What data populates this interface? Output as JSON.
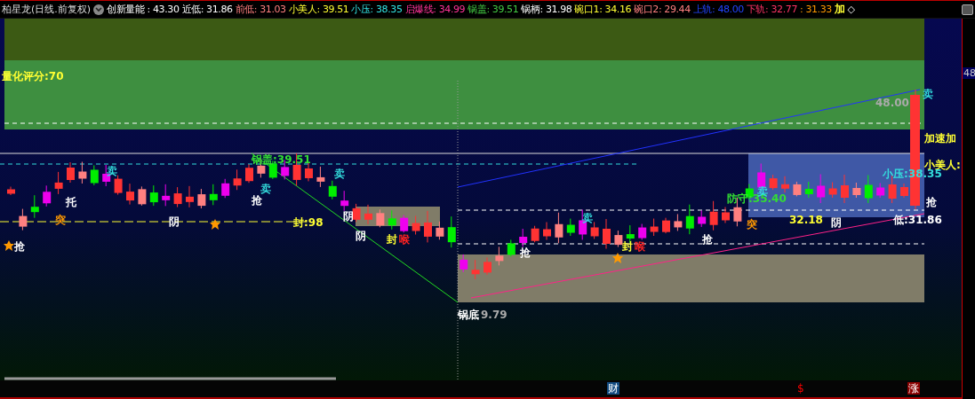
{
  "title": "柏星龙(日线.前复权)",
  "indicator": {
    "name": "创新量能",
    "value": ": 43.30"
  },
  "readings": [
    {
      "label": "近低:",
      "value": "31.86",
      "color": "#ffffff"
    },
    {
      "label": "前低:",
      "value": "31.03",
      "color": "#ff7f7f"
    },
    {
      "label": "小美人:",
      "value": "39.51",
      "color": "#ffff33"
    },
    {
      "label": "小压:",
      "value": "38.35",
      "color": "#33e6e6"
    },
    {
      "label": "启爆线:",
      "value": "34.99",
      "color": "#ff3399"
    },
    {
      "label": "锅盖:",
      "value": "39.51",
      "color": "#44cc44"
    },
    {
      "label": "锅柄:",
      "value": "31.98",
      "color": "#ffffff"
    },
    {
      "label": "碗口1:",
      "value": "34.16",
      "color": "#ffff33"
    },
    {
      "label": "碗口2:",
      "value": "29.44",
      "color": "#ff8080"
    },
    {
      "label": "上轨:",
      "value": "48.00",
      "color": "#2244ff"
    },
    {
      "label": "下轨:",
      "value": "32.77",
      "color": "#ff3366"
    },
    {
      "value": ": 31.33",
      "color": "#ff9900"
    },
    {
      "label": "加",
      "color": "#ffff33"
    }
  ],
  "collapse_symbol": "◇",
  "annotations": [
    {
      "text": "量化评分:70",
      "color": "#ffff33"
    },
    {
      "text": "锅盖:39.51",
      "color": "#33dd33"
    },
    {
      "text": "48.00",
      "color": "#aaaaaa"
    },
    {
      "text": "卖",
      "color": "#33dddd"
    },
    {
      "text": "加速加",
      "color": "#ffff33"
    },
    {
      "text": "卖",
      "color": "#33dddd"
    },
    {
      "text": "卖",
      "color": "#33dddd"
    },
    {
      "text": "卖",
      "color": "#33dddd"
    },
    {
      "text": "小美人:",
      "color": "#ffff33"
    },
    {
      "text": "小压:38.35",
      "color": "#33dddd"
    },
    {
      "text": "托",
      "color": "#ffffff"
    },
    {
      "text": "突",
      "color": "#ff9900"
    },
    {
      "text": "阴",
      "color": "#ffffff"
    },
    {
      "text": "抢",
      "color": "#ffffff"
    },
    {
      "text": "抢",
      "color": "#ffffff"
    },
    {
      "text": "封:98",
      "color": "#ffff33"
    },
    {
      "text": "阴",
      "color": "#ffffff"
    },
    {
      "text": "阴",
      "color": "#ffffff"
    },
    {
      "text": "封",
      "color": "#ffff33"
    },
    {
      "text": "喉",
      "color": "#ff2222"
    },
    {
      "text": "锅底",
      "color": "#ffffff"
    },
    {
      "text": "9.79",
      "color": "#aaaaaa"
    },
    {
      "text": "抢",
      "color": "#ffffff"
    },
    {
      "text": "卖",
      "color": "#33dddd"
    },
    {
      "text": "封",
      "color": "#ffff33"
    },
    {
      "text": "喉",
      "color": "#ff2222"
    },
    {
      "text": "抢",
      "color": "#ffffff"
    },
    {
      "text": "防守:35.40",
      "color": "#33dd33"
    },
    {
      "text": "卖",
      "color": "#33dddd"
    },
    {
      "text": "突",
      "color": "#ff9900"
    },
    {
      "text": "32.18",
      "color": "#ffff33"
    },
    {
      "text": "阴",
      "color": "#ffffff"
    },
    {
      "text": "抢",
      "color": "#ffffff"
    },
    {
      "text": "低:31.86",
      "color": "#ffffff"
    }
  ],
  "price_axis": {
    "label": "48"
  },
  "markers": [
    {
      "text": "财",
      "kind": "finance"
    },
    {
      "text": "$",
      "kind": "dollar"
    },
    {
      "text": "涨",
      "kind": "rise"
    }
  ]
}
